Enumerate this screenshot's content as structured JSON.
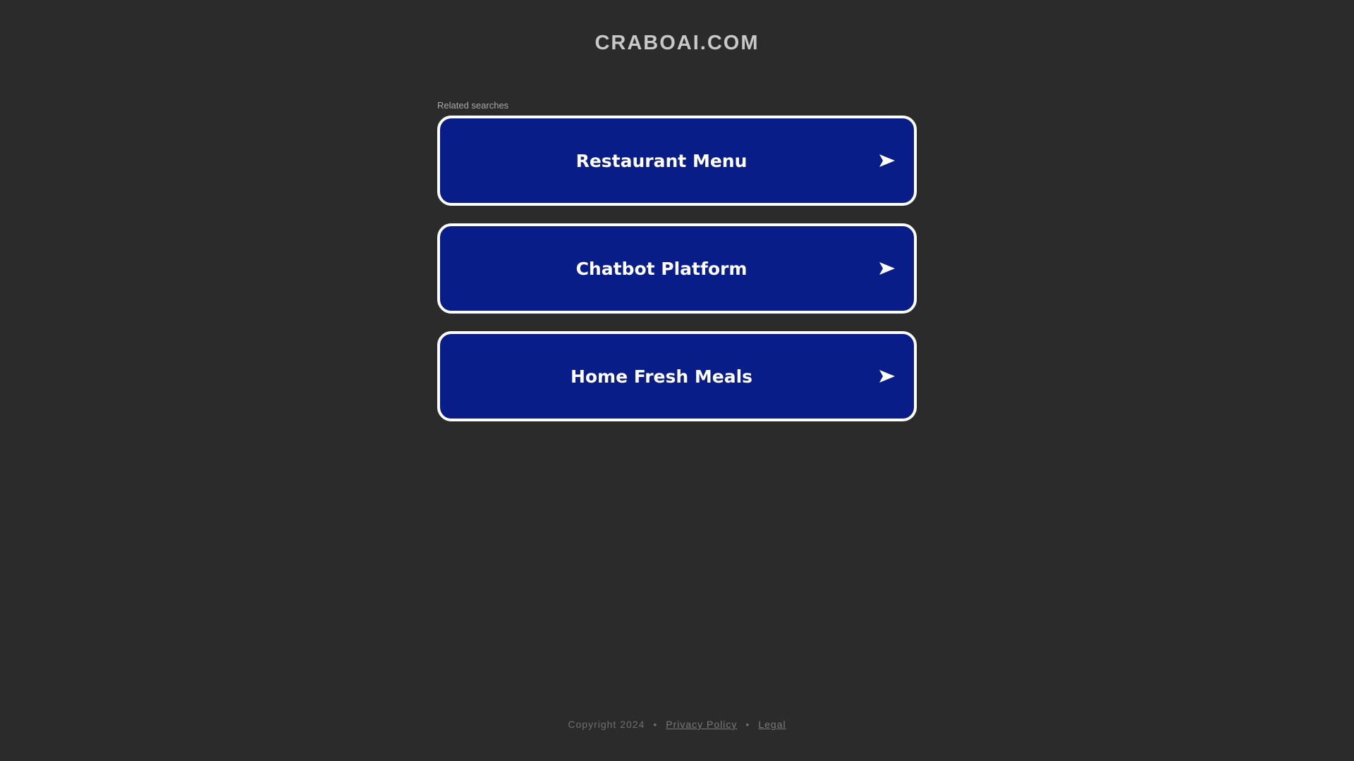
{
  "site": {
    "title": "CRABOAI.COM"
  },
  "related_searches": {
    "label": "Related searches",
    "items": [
      {
        "label": "Restaurant Menu",
        "icon": "arrow-right-icon"
      },
      {
        "label": "Chatbot Platform",
        "icon": "arrow-right-icon"
      },
      {
        "label": "Home Fresh Meals",
        "icon": "arrow-right-icon"
      }
    ]
  },
  "footer": {
    "copyright": "Copyright 2024",
    "separator": "•",
    "privacy_label": "Privacy Policy",
    "legal_label": "Legal"
  },
  "colors": {
    "background": "#2b2b2b",
    "button_fill": "#081d87",
    "button_border": "#ffffff"
  }
}
